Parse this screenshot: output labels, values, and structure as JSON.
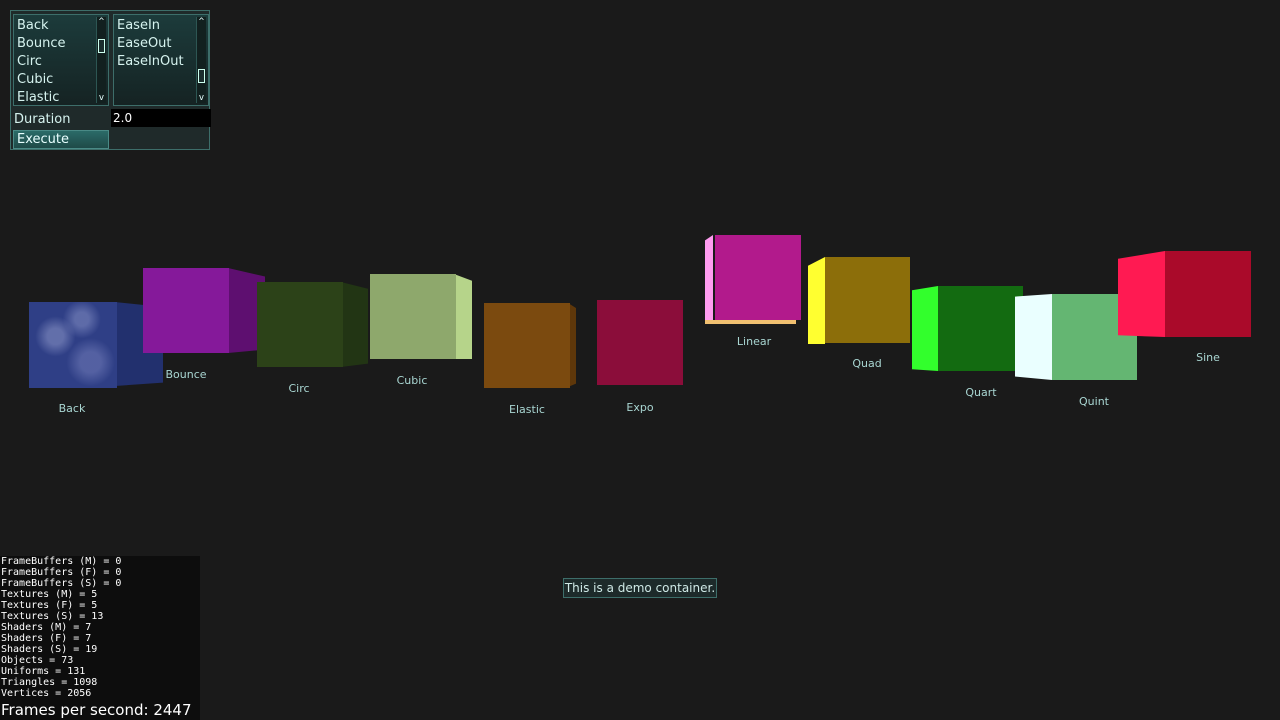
{
  "panel": {
    "easing_types": [
      "Back",
      "Bounce",
      "Circ",
      "Cubic",
      "Elastic"
    ],
    "easing_modes": [
      "EaseIn",
      "EaseOut",
      "EaseInOut"
    ],
    "scroll_up_glyph": "^",
    "scroll_down_glyph": "v",
    "duration_label": "Duration",
    "duration_value": "2.0",
    "execute_label": "Execute"
  },
  "cubes": [
    {
      "label": "Back",
      "front_color": "#2f3f86",
      "side_color": "#22306e"
    },
    {
      "label": "Bounce",
      "front_color": "#85199a",
      "side_color": "#5e0f70"
    },
    {
      "label": "Circ",
      "front_color": "#2c4218",
      "side_color": "#223514"
    },
    {
      "label": "Cubic",
      "front_color": "#8ea86c",
      "side_color": "#b6d48a"
    },
    {
      "label": "Elastic",
      "front_color": "#7b4a0f",
      "side_color": "#5e370a"
    },
    {
      "label": "Expo",
      "front_color": "#8b0d3a",
      "side_color": "#6b0a2d"
    },
    {
      "label": "Linear",
      "front_color": "#b21a8c",
      "side_color": "#ff9cf0"
    },
    {
      "label": "Quad",
      "front_color": "#8c6e0a",
      "side_color": "#ffff30"
    },
    {
      "label": "Quart",
      "front_color": "#136b11",
      "side_color": "#32ff2c"
    },
    {
      "label": "Quint",
      "front_color": "#64b672",
      "side_color": "#eaffff"
    },
    {
      "label": "Sine",
      "front_color": "#aa0a2a",
      "side_color": "#ff1a52"
    }
  ],
  "demo_container_text": "This is a demo container.",
  "stats": {
    "lines": [
      "FrameBuffers (M) = 0",
      "FrameBuffers (F) = 0",
      "FrameBuffers (S) = 0",
      "Textures (M) = 5",
      "Textures (F) = 5",
      "Textures (S) = 13",
      "Shaders (M) = 7",
      "Shaders (F) = 7",
      "Shaders (S) = 19",
      "Objects = 73",
      "Uniforms = 131",
      "Triangles = 1098",
      "Vertices = 2056"
    ],
    "fps_text": "Frames per second: 2447"
  }
}
